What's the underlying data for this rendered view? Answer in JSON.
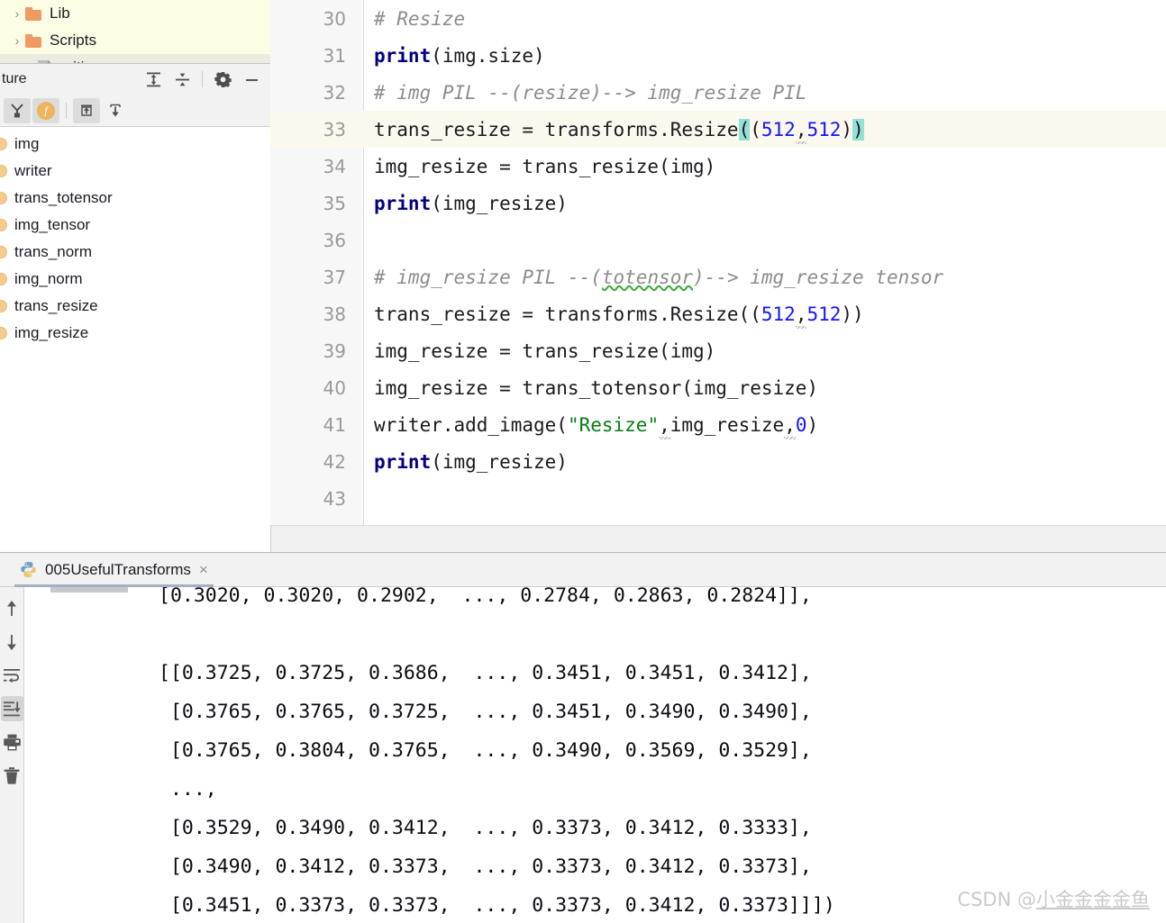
{
  "project_tree": {
    "rows": [
      {
        "icon": "folder-icon",
        "label": "Lib",
        "expander": "›",
        "nested": false
      },
      {
        "icon": "folder-icon",
        "label": "Scripts",
        "expander": "›",
        "nested": false
      },
      {
        "icon": "file-icon",
        "label": ".gitignore",
        "expander": "",
        "nested": true
      }
    ]
  },
  "structure_panel": {
    "title": "ture",
    "header_icons": [
      {
        "name": "expand-all-icon",
        "tooltip": "Expand All"
      },
      {
        "name": "collapse-all-icon",
        "tooltip": "Collapse All"
      },
      {
        "name": "gear-icon",
        "tooltip": "Settings"
      },
      {
        "name": "minimize-icon",
        "tooltip": "Hide"
      }
    ],
    "toolbar_icons": [
      {
        "name": "show-inherited-icon",
        "label": ""
      },
      {
        "name": "show-fields-icon",
        "label": "f"
      },
      {
        "name": "sort-ascending-icon",
        "label": ""
      },
      {
        "name": "sort-descending-icon",
        "label": ""
      }
    ],
    "items": [
      {
        "icon": "field-icon",
        "label": "img"
      },
      {
        "icon": "field-icon",
        "label": "writer"
      },
      {
        "icon": "field-icon",
        "label": "trans_totensor"
      },
      {
        "icon": "field-icon",
        "label": "img_tensor"
      },
      {
        "icon": "field-icon",
        "label": "trans_norm"
      },
      {
        "icon": "field-icon",
        "label": "img_norm"
      },
      {
        "icon": "field-icon",
        "label": "trans_resize"
      },
      {
        "icon": "field-icon",
        "label": "img_resize"
      }
    ]
  },
  "editor": {
    "current_line": 33,
    "lines": [
      {
        "n": "30",
        "spans": [
          {
            "t": "# Resize",
            "c": "tok-com"
          }
        ]
      },
      {
        "n": "31",
        "spans": [
          {
            "t": "print",
            "c": "tok-kw"
          },
          {
            "t": "(img.size)",
            "c": "tok-plain"
          }
        ]
      },
      {
        "n": "32",
        "spans": [
          {
            "t": "# img PIL --(resize)--> img_resize PIL",
            "c": "tok-com"
          }
        ]
      },
      {
        "n": "33",
        "spans": [
          {
            "t": "trans_resize = transforms.Resize",
            "c": "tok-plain"
          },
          {
            "t": "(",
            "c": "tok-plain brk-hl"
          },
          {
            "t": "(",
            "c": "tok-plain"
          },
          {
            "t": "512",
            "c": "tok-num"
          },
          {
            "t": ",",
            "c": "tok-plain tilde-mark"
          },
          {
            "t": "512",
            "c": "tok-num"
          },
          {
            "t": ")",
            "c": "tok-plain"
          },
          {
            "t": ")",
            "c": "tok-plain brk-hl"
          }
        ]
      },
      {
        "n": "34",
        "spans": [
          {
            "t": "img_resize = trans_resize(img)",
            "c": "tok-plain"
          }
        ]
      },
      {
        "n": "35",
        "spans": [
          {
            "t": "print",
            "c": "tok-kw"
          },
          {
            "t": "(img_resize)",
            "c": "tok-plain"
          }
        ]
      },
      {
        "n": "36",
        "spans": [
          {
            "t": "",
            "c": "tok-plain"
          }
        ]
      },
      {
        "n": "37",
        "spans": [
          {
            "t": "# img_resize PIL --(",
            "c": "tok-com"
          },
          {
            "t": "totensor",
            "c": "tok-com squiggle"
          },
          {
            "t": ")--> img_resize tensor",
            "c": "tok-com"
          }
        ]
      },
      {
        "n": "38",
        "spans": [
          {
            "t": "trans_resize = transforms.Resize((",
            "c": "tok-plain"
          },
          {
            "t": "512",
            "c": "tok-num"
          },
          {
            "t": ",",
            "c": "tok-plain tilde-mark"
          },
          {
            "t": "512",
            "c": "tok-num"
          },
          {
            "t": "))",
            "c": "tok-plain"
          }
        ]
      },
      {
        "n": "39",
        "spans": [
          {
            "t": "img_resize = trans_resize(img)",
            "c": "tok-plain"
          }
        ]
      },
      {
        "n": "40",
        "spans": [
          {
            "t": "img_resize = trans_totensor(img_resize)",
            "c": "tok-plain"
          }
        ]
      },
      {
        "n": "41",
        "spans": [
          {
            "t": "writer.add_image(",
            "c": "tok-plain"
          },
          {
            "t": "\"Resize\"",
            "c": "tok-str"
          },
          {
            "t": ",",
            "c": "tok-plain tilde-mark"
          },
          {
            "t": "img_resize",
            "c": "tok-plain"
          },
          {
            "t": ",",
            "c": "tok-plain tilde-mark"
          },
          {
            "t": "0",
            "c": "tok-num"
          },
          {
            "t": ")",
            "c": "tok-plain"
          }
        ]
      },
      {
        "n": "42",
        "spans": [
          {
            "t": "print",
            "c": "tok-kw"
          },
          {
            "t": "(img_resize)",
            "c": "tok-plain"
          }
        ]
      },
      {
        "n": "43",
        "spans": [
          {
            "t": "",
            "c": "tok-plain"
          }
        ]
      }
    ]
  },
  "run_window": {
    "tab": {
      "label": "005UsefulTransforms",
      "icon": "python-file-icon",
      "close": "×"
    },
    "sidebar_buttons": [
      {
        "name": "scroll-up-icon",
        "glyph": "↑",
        "active": false
      },
      {
        "name": "scroll-down-icon",
        "glyph": "↓",
        "active": false
      },
      {
        "name": "soft-wrap-icon",
        "glyph": "wrap",
        "active": false
      },
      {
        "name": "scroll-to-end-icon",
        "glyph": "end",
        "active": true
      },
      {
        "name": "print-icon",
        "glyph": "print",
        "active": false
      },
      {
        "name": "clear-all-icon",
        "glyph": "trash",
        "active": false
      }
    ],
    "console_lines": [
      "[0.3020, 0.3020, 0.2902,  ..., 0.2784, 0.2863, 0.2824]],",
      "",
      "[[0.3725, 0.3725, 0.3686,  ..., 0.3451, 0.3451, 0.3412],",
      " [0.3765, 0.3765, 0.3725,  ..., 0.3451, 0.3490, 0.3490],",
      " [0.3765, 0.3804, 0.3765,  ..., 0.3490, 0.3569, 0.3529],",
      " ...,",
      " [0.3529, 0.3490, 0.3412,  ..., 0.3373, 0.3412, 0.3333],",
      " [0.3490, 0.3412, 0.3373,  ..., 0.3373, 0.3412, 0.3373],",
      " [0.3451, 0.3373, 0.3373,  ..., 0.3373, 0.3412, 0.3373]]])"
    ]
  },
  "watermark": {
    "prefix": "CSDN @",
    "name": "小金金金金鱼"
  },
  "colors": {
    "current_line_bg": "#fbf9ee",
    "tree_bg": "#fdfce4",
    "bracket_highlight": "#93e0d7",
    "folder_icon": "#ef9a62",
    "field_icon": "#f7cb8d",
    "number_token": "#1414ff",
    "string_token": "#067d17",
    "comment_token": "#8c8c8c",
    "keyword_token": "#000080"
  }
}
